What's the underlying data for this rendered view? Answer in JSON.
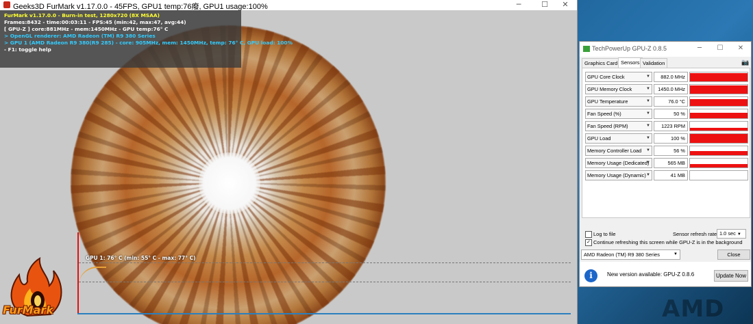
{
  "furmark": {
    "title": "Geeks3D FurMark v1.17.0.0 - 45FPS, GPU1 temp:76癈, GPU1 usage:100%",
    "hud": {
      "line1": "FurMark v1.17.0.0 - Burn-in test, 1280x720 (8X MSAA)",
      "line2": "Frames:8432 - time:00:03:11 - FPS:45 (min:42, max:47, avg:44)",
      "line3": "[ GPU-Z ] core:881MHz - mem:1450MHz - GPU temp:76° C",
      "line4": "> OpenGL renderer: AMD Radeon (TM) R9 380 Series",
      "line5": "> GPU 1 (AMD Radeon R9 380(R9 285) - core: 905MHz, mem: 1450MHz, temp: 76° C, GPU load: 100%",
      "line6": "- F1: toggle help"
    },
    "graph_label": "GPU 1: 76° C (min: 55° C - max: 77° C)",
    "logo_text": "FurMark",
    "colors": {
      "hud_title": "#ffff33",
      "hud_text": "#ffffff",
      "hud_cyan": "#33ccff"
    }
  },
  "gpuz": {
    "title": "TechPowerUp GPU-Z 0.8.5",
    "tabs": [
      "Graphics Card",
      "Sensors",
      "Validation"
    ],
    "active_tab": "Sensors",
    "camera_icon": "camera-icon",
    "sensors": [
      {
        "name": "GPU Core Clock",
        "value": "882.0 MHz",
        "level": 0.92
      },
      {
        "name": "GPU Memory Clock",
        "value": "1450.0 MHz",
        "level": 0.9
      },
      {
        "name": "GPU Temperature",
        "value": "76.0 °C",
        "level": 0.75
      },
      {
        "name": "Fan Speed (%)",
        "value": "50 %",
        "level": 0.6
      },
      {
        "name": "Fan Speed (RPM)",
        "value": "1223 RPM",
        "level": 0.3
      },
      {
        "name": "GPU Load",
        "value": "100 %",
        "level": 1.0
      },
      {
        "name": "Memory Controller Load",
        "value": "56 %",
        "level": 0.45
      },
      {
        "name": "Memory Usage (Dedicated)",
        "value": "565 MB",
        "level": 0.35
      },
      {
        "name": "Memory Usage (Dynamic)",
        "value": "41 MB",
        "level": 0.0
      }
    ],
    "log_to_file": "Log to file",
    "refresh_label": "Sensor refresh rate:",
    "refresh_value": "1.0 sec",
    "continue_label": "Continue refreshing this screen while GPU-Z is in the background",
    "gpu_select": "AMD Radeon (TM) R9 380 Series",
    "close_label": "Close",
    "notice_text": "New version available: GPU-Z 0.8.6",
    "update_label": "Update Now",
    "colors": {
      "graph": "#ee1111"
    }
  },
  "desktop": {
    "watermark": "AMD"
  }
}
